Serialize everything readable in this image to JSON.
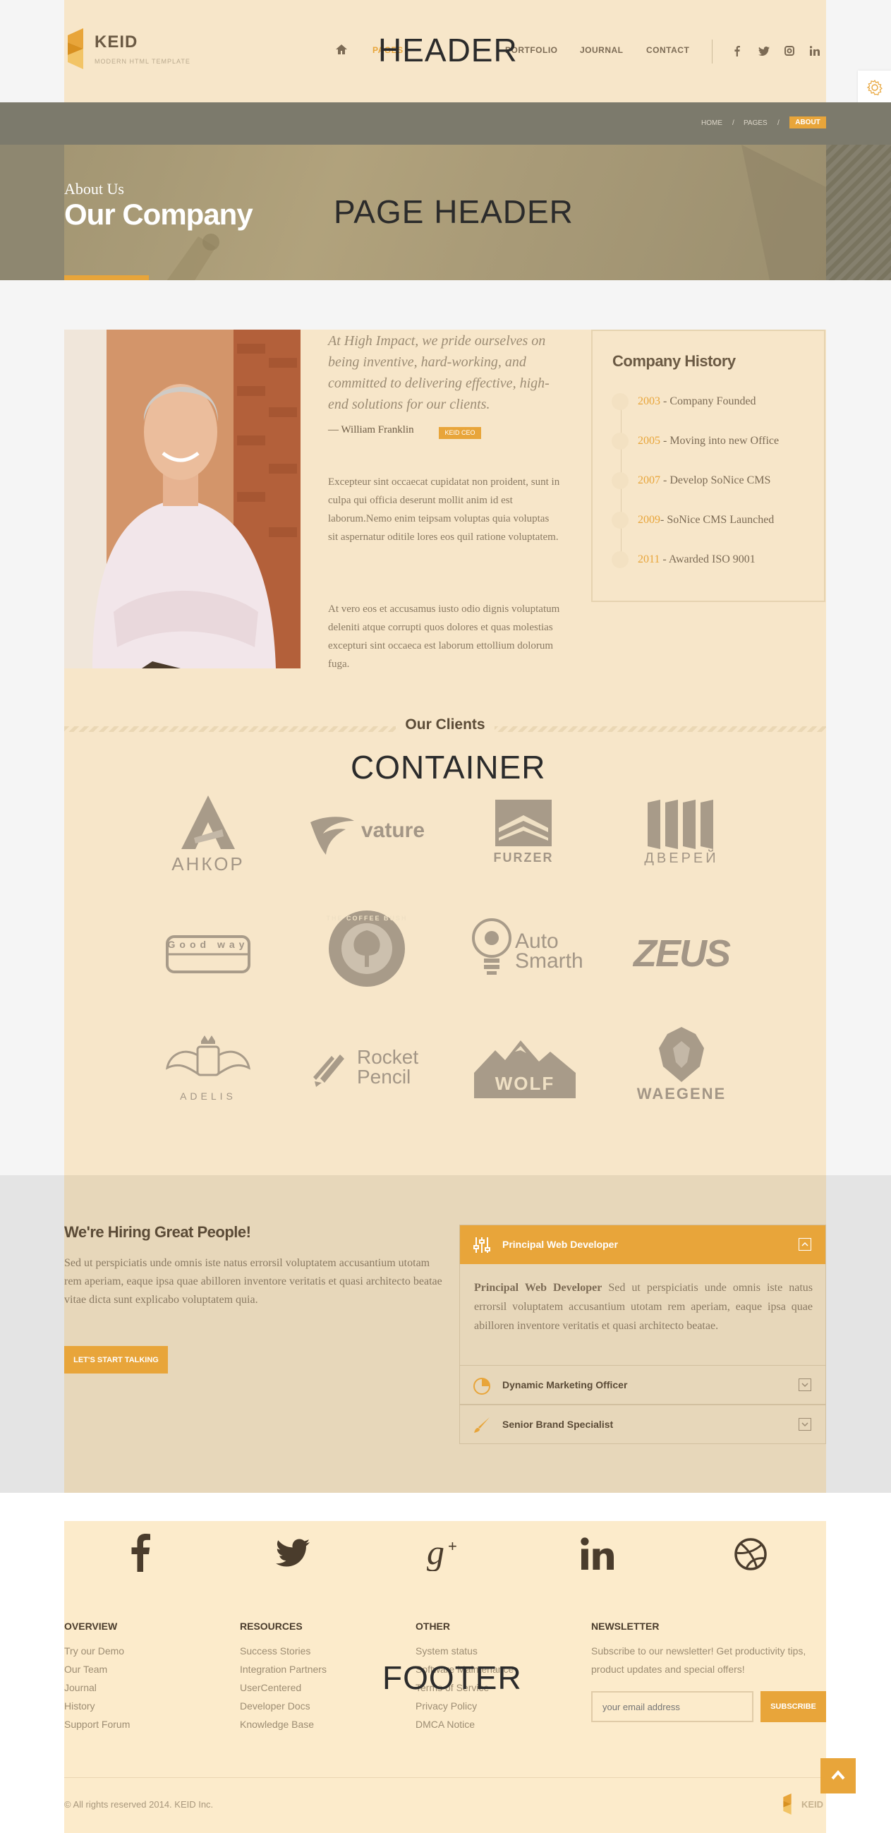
{
  "header": {
    "label": "HEADER",
    "logo_text": "KEID",
    "logo_sub": "MODERN HTML TEMPLATE",
    "nav": [
      {
        "label": "PAGES"
      },
      {
        "label": "PORTFOLIO"
      },
      {
        "label": "JOURNAL"
      },
      {
        "label": "CONTACT"
      }
    ],
    "social": [
      "f",
      "t",
      "i",
      "in"
    ]
  },
  "page_header": {
    "label": "PAGE HEADER",
    "breadcrumbs": [
      "HOME",
      "/",
      "PAGES",
      "/"
    ],
    "active_crumb": "ABOUT",
    "eyebrow": "About Us",
    "title": "Our Company"
  },
  "container": {
    "label": "CONTAINER",
    "quote": "At High Impact, we pride ourselves on being inventive, hard-working, and committed to delivering effective, high-end solutions for our clients.",
    "author": "—  William Franklin",
    "author_badge": "KEID CEO",
    "paragraphs": [
      "Excepteur sint occaecat cupidatat non proident, sunt in culpa qui officia deserunt mollit anim id est laborum.Nemo enim teipsam voluptas quia voluptas sit aspernatur oditile lores eos quil ratione voluptatem.",
      "At vero eos et accusamus iusto odio dignis voluptatum deleniti atque corrupti quos dolores et quas molestias excepturi sint occaeca est laborum ettollium dolorum fuga."
    ],
    "history": {
      "title": "Company History",
      "items": [
        {
          "year": "2003",
          "text": " - Company Founded"
        },
        {
          "year": "2005",
          "text": " - Moving into new Office"
        },
        {
          "year": "2007",
          "text": " - Develop SoNice CMS"
        },
        {
          "year": "2009",
          "text": "- SoNice CMS Launched"
        },
        {
          "year": "2011",
          "text": " - Awarded ISO 9001"
        }
      ]
    },
    "clients_title": "Our Clients",
    "clients": [
      "АНКОР",
      "vature",
      "FURZER",
      "ДВЕРЕЙ",
      "Good way",
      "THE COFFEE BUSH",
      "Auto Smarth",
      "ZEUS",
      "ADELIS",
      "Rocket Pencil",
      "WOLF",
      "WAEGENE"
    ]
  },
  "hiring": {
    "title": "We're Hiring Great People!",
    "text": "Sed ut perspiciatis unde omnis iste natus errorsil voluptatem accusantium utotam rem aperiam, eaque ipsa quae abilloren inventore veritatis et quasi architecto beatae vitae dicta sunt explicabo voluptatem quia.",
    "button": "LET'S START TALKING",
    "jobs": [
      {
        "title": "Principal Web Developer",
        "body_lead": "Principal Web Developer",
        "body": " Sed ut perspiciatis unde omnis iste natus errorsil voluptatem accusantium utotam rem aperiam, eaque ipsa quae abilloren inventore veritatis et quasi architecto beatae."
      },
      {
        "title": "Dynamic Marketing Officer"
      },
      {
        "title": "Senior Brand Specialist"
      }
    ]
  },
  "footer": {
    "label": "FOOTER",
    "columns": [
      {
        "title": "OVERVIEW",
        "links": [
          "Try our Demo",
          "Our Team",
          "Journal",
          "History",
          "Support Forum"
        ]
      },
      {
        "title": "RESOURCES",
        "links": [
          "Success Stories",
          "Integration Partners",
          "UserCentered",
          "Developer Docs",
          "Knowledge Base"
        ]
      },
      {
        "title": "OTHER",
        "links": [
          "System status",
          "Software Maintenance",
          "Terms of Service",
          "Privacy Policy",
          "DMCA Notice"
        ]
      }
    ],
    "newsletter": {
      "title": "NEWSLETTER",
      "text": "Subscribe to our newsletter! Get productivity tips, product updates and special offers!",
      "placeholder": "your email address",
      "button": "SUBSCRIBE"
    },
    "copyright": "© All rights reserved 2014. KEID Inc.",
    "logo_text": "KEID"
  },
  "colors": {
    "accent": "#e8a53a",
    "cream": "#f7e6c9",
    "dark": "#4a3c2c"
  }
}
